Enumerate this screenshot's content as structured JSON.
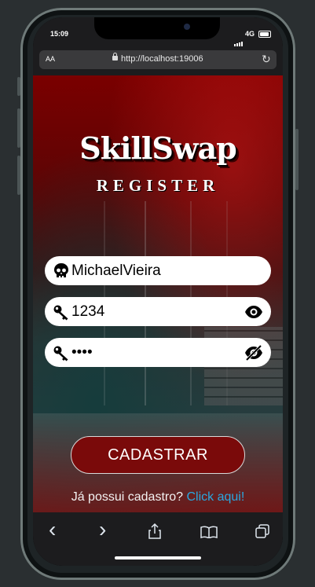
{
  "status_bar": {
    "time": "15:09",
    "network": "4G"
  },
  "browser": {
    "text_size_label": "AA",
    "url": "http://localhost:19006"
  },
  "app": {
    "logo": "SkillSwap",
    "subtitle": "REGISTER",
    "username_value": "MichaelVieira",
    "password_value": "1234",
    "confirm_password_value": "••••",
    "submit_label": "CADASTRAR",
    "login_prompt": "Já possui cadastro?",
    "login_link": "Click aqui!"
  },
  "toolbar": {
    "back": "‹",
    "forward": "›"
  },
  "colors": {
    "button": "#7a0a0a",
    "link": "#29a8e0"
  }
}
